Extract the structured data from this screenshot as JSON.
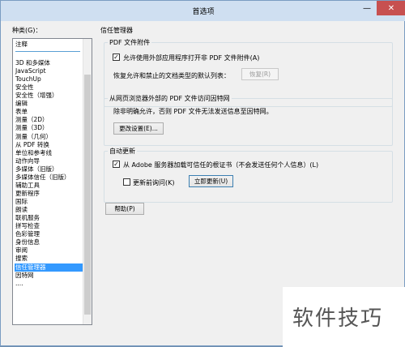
{
  "window": {
    "title": "首选项",
    "min_glyph": "—",
    "close_glyph": "✕"
  },
  "category_label": "种类(G)：",
  "categories": [
    "注释",
    "3D 和多媒体",
    "JavaScript",
    "TouchUp",
    "安全性",
    "安全性（增强）",
    "编辑",
    "表单",
    "测量（2D）",
    "测量（3D）",
    "测量（几何）",
    "从 PDF 转换",
    "单位和参考线",
    "动作向导",
    "多媒体（旧版）",
    "多媒体信任（旧版）",
    "辅助工具",
    "更新程序",
    "国际",
    "朗读",
    "联机服务",
    "拼写检查",
    "色彩管理",
    "身份信息",
    "审阅",
    "搜索",
    "信任管理器",
    "因特网",
    "...."
  ],
  "selected_category": "信任管理器",
  "panel": {
    "title": "信任管理器",
    "pdf_attach": {
      "caption": "PDF 文件附件",
      "checkbox_label": "允许使用外部应用程序打开非 PDF 文件附件(A)",
      "checked": true,
      "restore_text": "恢复允许和禁止的文档类型的默认列表：",
      "restore_button": "恢复(R)"
    },
    "internet": {
      "caption": "从网页浏览器外部的 PDF 文件访问因特网",
      "desc": "除非明确允许，否则 PDF 文件无法发送信息至因特网。",
      "change_button": "更改设置(E)..."
    },
    "auto_update": {
      "caption": "自动更新",
      "checkbox_label": "从 Adobe 服务器加载可信任的根证书（不会发送任何个人信息）(L)",
      "checked": true,
      "ask_label": "更新前询问(K)",
      "ask_checked": false,
      "update_button": "立即更新(U)"
    },
    "help_button": "帮助(P)"
  },
  "watermark": "软件技巧"
}
